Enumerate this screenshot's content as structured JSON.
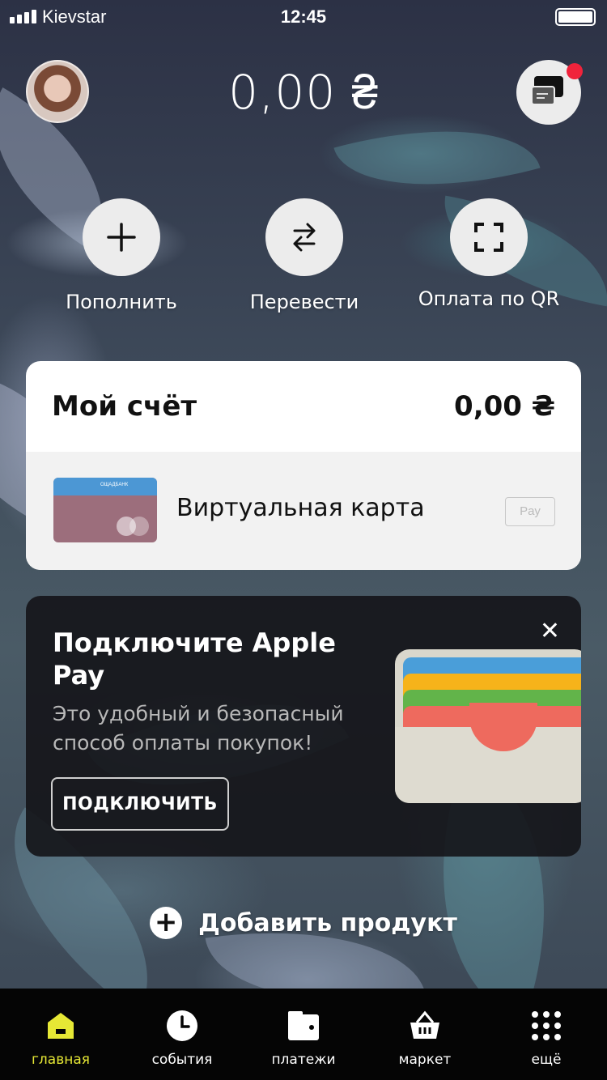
{
  "status_bar": {
    "carrier": "Kievstar",
    "time": "12:45"
  },
  "header": {
    "balance": "0,00 ₴"
  },
  "actions": [
    {
      "label": "Пополнить",
      "icon": "plus-icon"
    },
    {
      "label": "Перевести",
      "icon": "transfer-arrows-icon"
    },
    {
      "label": "Оплата по QR",
      "icon": "qr-scan-icon"
    }
  ],
  "account": {
    "title": "Мой счёт",
    "amount": "0,00 ₴",
    "card_label": "Виртуальная карта",
    "card_bank": "ОЩАДБАНК",
    "apple_pay_badge": " Pay"
  },
  "promo": {
    "title": "Подключите Apple Pay",
    "text": "Это удобный и безопасный способ оплаты покупок!",
    "button": "подключить",
    "close": "✕"
  },
  "add_product": {
    "label": "Добавить продукт"
  },
  "tabbar": {
    "items": [
      {
        "label": "главная",
        "icon": "home-icon",
        "active": true
      },
      {
        "label": "события",
        "icon": "clock-icon",
        "active": false
      },
      {
        "label": "платежи",
        "icon": "wallet-icon",
        "active": false
      },
      {
        "label": "маркет",
        "icon": "basket-icon",
        "active": false
      },
      {
        "label": "ещё",
        "icon": "grid-dots-icon",
        "active": false
      }
    ]
  },
  "colors": {
    "accent": "#e6e835",
    "notification": "#f0233b",
    "tabbar": "#050505"
  }
}
